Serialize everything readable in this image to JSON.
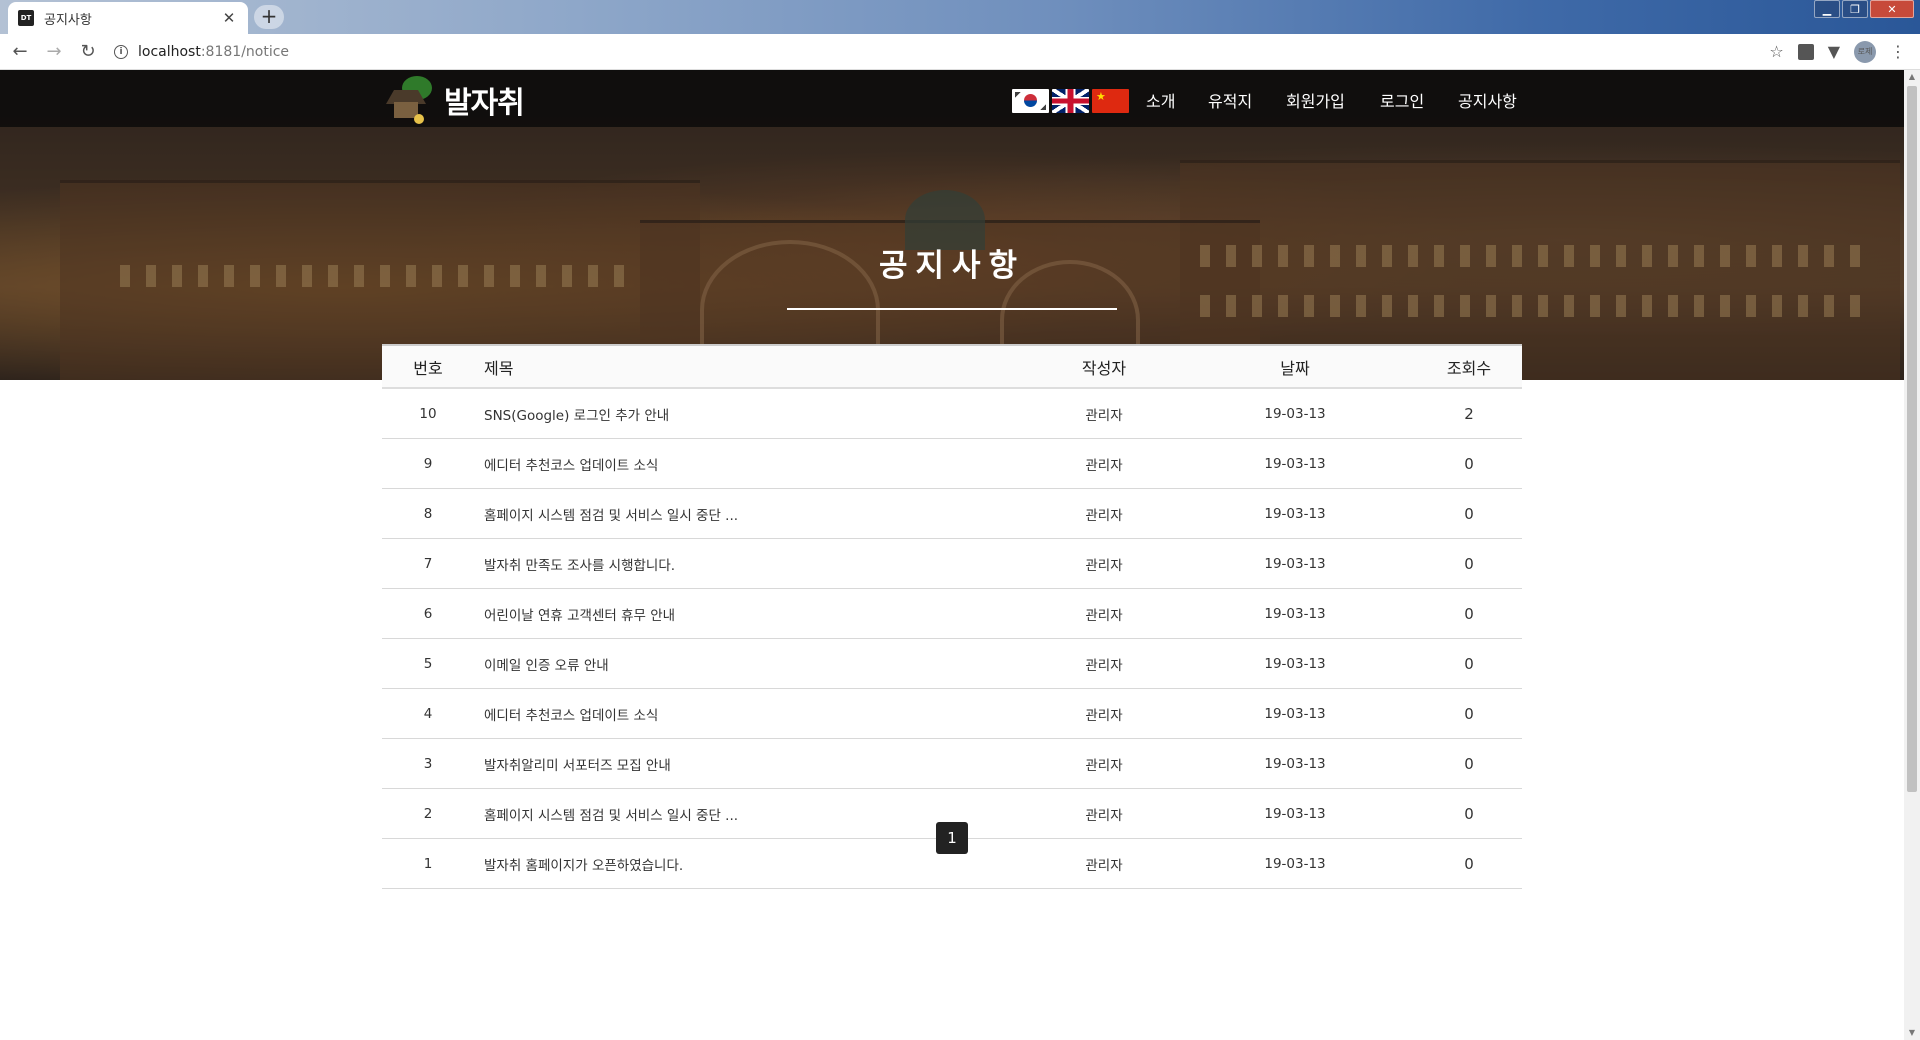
{
  "browser": {
    "tab_title": "공지사항",
    "favicon_text": "DT",
    "url_host": "localhost",
    "url_path": ":8181/notice",
    "profile_text": "로제"
  },
  "site": {
    "logo_text": "발자취",
    "nav": [
      "소개",
      "유적지",
      "회원가입",
      "로그인",
      "공지사항"
    ],
    "flags": [
      "korea-flag",
      "uk-flag",
      "china-flag"
    ]
  },
  "hero": {
    "title": "공지사항"
  },
  "board": {
    "headers": {
      "no": "번호",
      "title": "제목",
      "writer": "작성자",
      "date": "날짜",
      "views": "조회수"
    },
    "rows": [
      {
        "no": "10",
        "title": "SNS(Google) 로그인 추가 안내",
        "writer": "관리자",
        "date": "19-03-13",
        "views": "2"
      },
      {
        "no": "9",
        "title": "에디터 추천코스 업데이트 소식",
        "writer": "관리자",
        "date": "19-03-13",
        "views": "0"
      },
      {
        "no": "8",
        "title": "홈페이지 시스템 점검 및 서비스 일시 중단 ...",
        "writer": "관리자",
        "date": "19-03-13",
        "views": "0"
      },
      {
        "no": "7",
        "title": "발자취 만족도 조사를 시행합니다.",
        "writer": "관리자",
        "date": "19-03-13",
        "views": "0"
      },
      {
        "no": "6",
        "title": "어린이날 연휴 고객센터 휴무 안내",
        "writer": "관리자",
        "date": "19-03-13",
        "views": "0"
      },
      {
        "no": "5",
        "title": "이메일 인증 오류 안내",
        "writer": "관리자",
        "date": "19-03-13",
        "views": "0"
      },
      {
        "no": "4",
        "title": "에디터 추천코스 업데이트 소식",
        "writer": "관리자",
        "date": "19-03-13",
        "views": "0"
      },
      {
        "no": "3",
        "title": "발자취알리미 서포터즈 모집 안내",
        "writer": "관리자",
        "date": "19-03-13",
        "views": "0"
      },
      {
        "no": "2",
        "title": "홈페이지 시스템 점검 및 서비스 일시 중단 ...",
        "writer": "관리자",
        "date": "19-03-13",
        "views": "0"
      },
      {
        "no": "1",
        "title": "발자취 홈페이지가 오픈하였습니다.",
        "writer": "관리자",
        "date": "19-03-13",
        "views": "0"
      }
    ]
  },
  "pagination": {
    "current": "1"
  }
}
